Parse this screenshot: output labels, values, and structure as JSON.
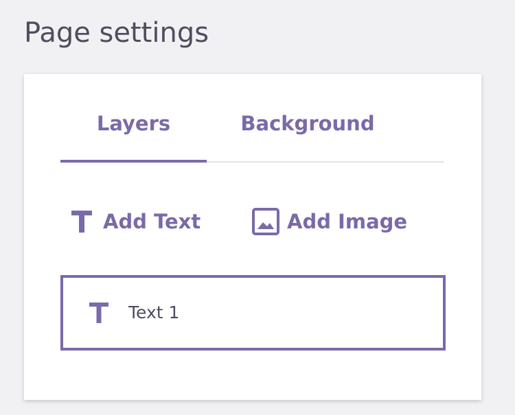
{
  "header": {
    "title": "Page settings"
  },
  "tabs": [
    {
      "label": "Layers",
      "active": true
    },
    {
      "label": "Background",
      "active": false
    }
  ],
  "actions": {
    "add_text_label": "Add Text",
    "add_text_icon": "text-t-icon",
    "add_image_label": "Add Image",
    "add_image_icon": "image-icon"
  },
  "layers": [
    {
      "label": "Text 1",
      "icon": "text-t-icon"
    }
  ],
  "colors": {
    "accent": "#7a6aa8",
    "text": "#4f4d5e",
    "background": "#f1f1f3",
    "panel": "#ffffff",
    "divider": "#e3e2e8"
  }
}
